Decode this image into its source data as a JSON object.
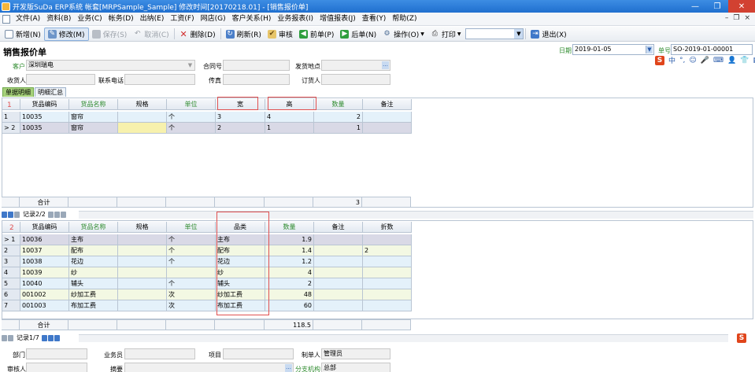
{
  "window": {
    "title": "开发版SuDa ERP系统  帐套[MRPSample_Sample] 修改时间[20170218.01] - [销售报价单]",
    "controls": [
      "—",
      "❐",
      "✕"
    ]
  },
  "menu": [
    "文件(A)",
    "资料(B)",
    "业务(C)",
    "帐务(D)",
    "出纳(E)",
    "工资(F)",
    "网店(G)",
    "客户关系(H)",
    "业务报表(I)",
    "增值报表(J)",
    "查看(Y)",
    "帮助(Z)"
  ],
  "mdi_controls": [
    "–",
    "❐",
    "×"
  ],
  "toolbar": {
    "new": "新增(N)",
    "edit": "修改(M)",
    "save": "保存(S)",
    "cancel": "取消(C)",
    "delete": "删除(D)",
    "refresh": "刷新(R)",
    "audit": "审核",
    "prev": "前单(P)",
    "next": "后单(N)",
    "ops": "操作(O)",
    "print": "打印",
    "exit": "退出(X)"
  },
  "header": {
    "page_title": "销售报价单",
    "date_label": "日期",
    "date_value": "2019-01-05",
    "docno_label": "单号",
    "docno_value": "SO-2019-01-00001",
    "customer_label": "客户",
    "customer_value": "深圳瑞电",
    "contract_label": "合同号",
    "ship_label": "发货地点",
    "receiver_label": "收货人",
    "phone_label": "联系电话",
    "fax_label": "传真",
    "orderer_label": "订货人"
  },
  "ime": {
    "logo": "S",
    "items": [
      "中",
      "°,",
      "☺",
      "🎤",
      "⌨",
      "👤",
      "👕",
      "▦"
    ]
  },
  "tabs": [
    "单据明细",
    "明细汇总"
  ],
  "grid1": {
    "columns": [
      "",
      "货品编码",
      "货品名称",
      "规格",
      "单位",
      "宽",
      "高",
      "数量",
      "备注"
    ],
    "rows": [
      {
        "rh": "1",
        "code": "10035",
        "name": "窗帘",
        "spec": "",
        "unit": "个",
        "w": "3",
        "h": "4",
        "qty": "2",
        "note": ""
      },
      {
        "rh": "> 2",
        "code": "10035",
        "name": "窗帘",
        "spec": "",
        "unit": "个",
        "w": "2",
        "h": "1",
        "qty": "1",
        "note": ""
      }
    ],
    "sum_label": "合计",
    "sum_qty": "3",
    "marker": "1"
  },
  "nav1": {
    "record": "记录2/2"
  },
  "grid2": {
    "columns": [
      "",
      "货品编码",
      "货品名称",
      "规格",
      "单位",
      "品类",
      "数量",
      "备注",
      "折数"
    ],
    "rows": [
      {
        "rh": "> 1",
        "code": "10036",
        "name": "主布",
        "spec": "",
        "unit": "个",
        "cat": "主布",
        "qty": "1.9",
        "note": "",
        "disc": ""
      },
      {
        "rh": "2",
        "code": "10037",
        "name": "配布",
        "spec": "",
        "unit": "个",
        "cat": "配布",
        "qty": "1.4",
        "note": "",
        "disc": "2"
      },
      {
        "rh": "3",
        "code": "10038",
        "name": "花边",
        "spec": "",
        "unit": "个",
        "cat": "花边",
        "qty": "1.2",
        "note": "",
        "disc": ""
      },
      {
        "rh": "4",
        "code": "10039",
        "name": "纱",
        "spec": "",
        "unit": "",
        "cat": "纱",
        "qty": "4",
        "note": "",
        "disc": ""
      },
      {
        "rh": "5",
        "code": "10040",
        "name": "辅头",
        "spec": "",
        "unit": "个",
        "cat": "辅头",
        "qty": "2",
        "note": "",
        "disc": ""
      },
      {
        "rh": "6",
        "code": "001002",
        "name": "纱加工费",
        "spec": "",
        "unit": "次",
        "cat": "纱加工费",
        "qty": "48",
        "note": "",
        "disc": ""
      },
      {
        "rh": "7",
        "code": "001003",
        "name": "布加工费",
        "spec": "",
        "unit": "次",
        "cat": "布加工费",
        "qty": "60",
        "note": "",
        "disc": ""
      }
    ],
    "sum_label": "合计",
    "sum_qty": "118.5",
    "marker": "2"
  },
  "nav2": {
    "record": "记录1/7"
  },
  "footer": {
    "dept_label": "部门",
    "sales_label": "业务员",
    "project_label": "项目",
    "maker_label": "制单人",
    "maker_value": "管理员",
    "auditor_label": "审核人",
    "summary_label": "摘要",
    "branch_label": "分支机构",
    "branch_value": "总部"
  }
}
